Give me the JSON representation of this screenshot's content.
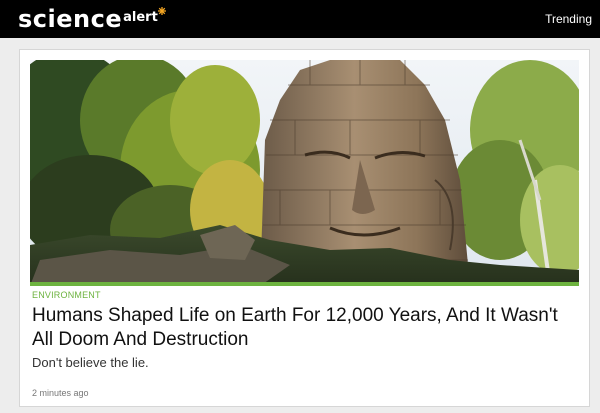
{
  "header": {
    "logo_main": "science",
    "logo_sub": "alert",
    "nav_trending": "Trending"
  },
  "article": {
    "category": "ENVIRONMENT",
    "headline": "Humans Shaped Life on Earth For 12,000 Years, And It Wasn't All Doom And Destruction",
    "dek": "Don't believe the lie.",
    "timestamp": "2 minutes ago",
    "image": "photo of a carved stone face tower among trees"
  },
  "colors": {
    "header_bg": "#000000",
    "accent_green": "#6db33f",
    "logo_spark": "#f5a623"
  }
}
